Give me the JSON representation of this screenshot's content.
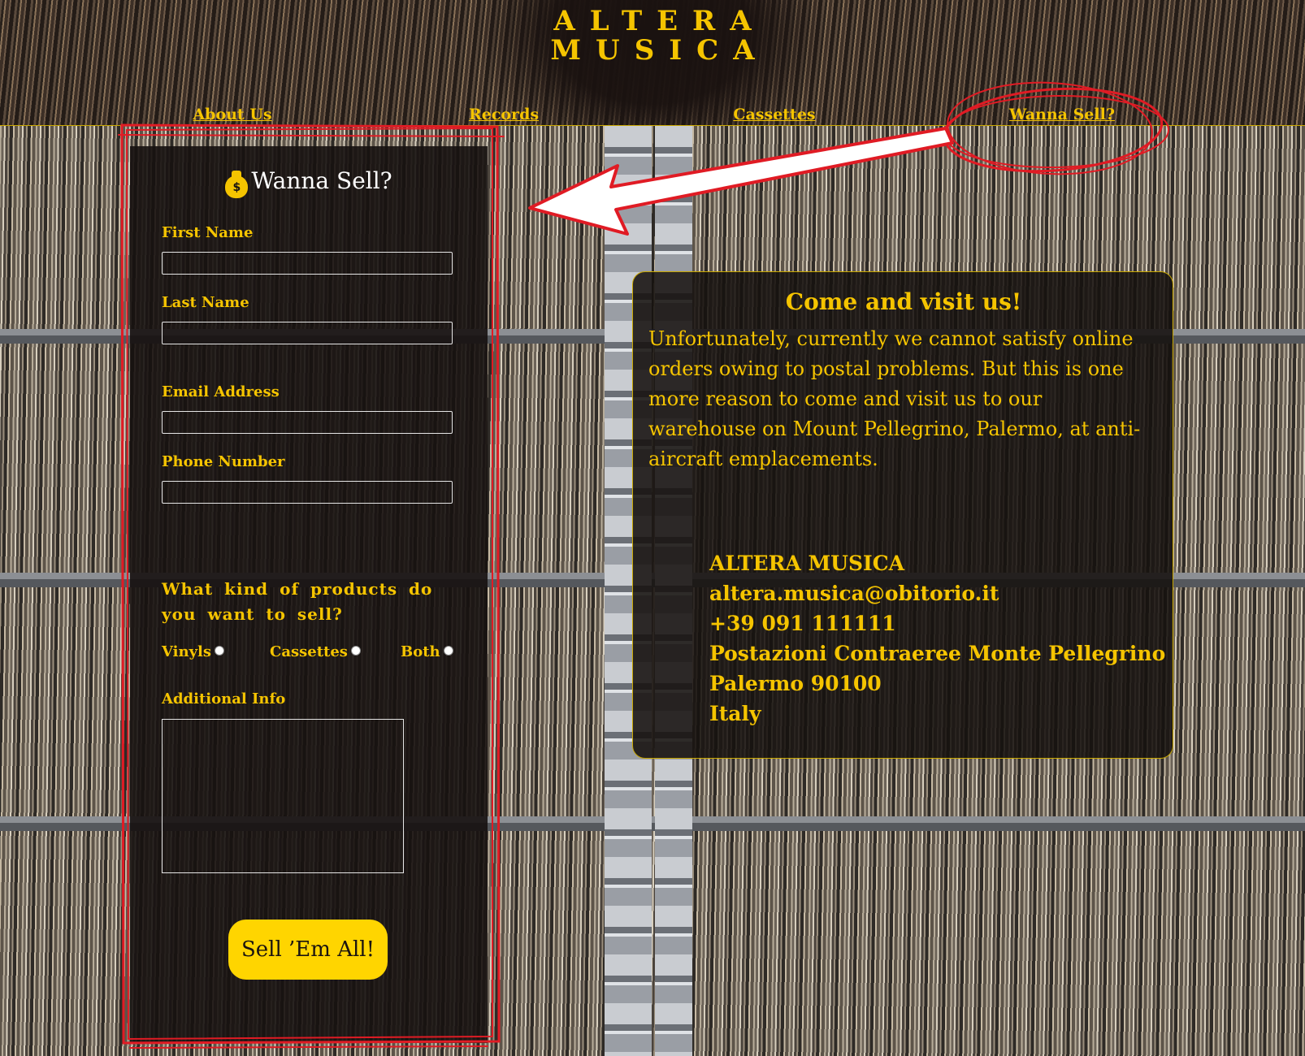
{
  "brand": {
    "line1": "ALTERA",
    "line2": "MUSICA"
  },
  "nav": {
    "about": "About Us",
    "records": "Records",
    "cassettes": "Cassettes",
    "sell": "Wanna Sell?"
  },
  "form": {
    "title": "Wanna Sell?",
    "bag_symbol": "$",
    "first_name_label": "First Name",
    "last_name_label": "Last Name",
    "email_label": "Email Address",
    "phone_label": "Phone Number",
    "question": "What kind of products do you want to sell?",
    "options": {
      "vinyls": "Vinyls",
      "cassettes": "Cassettes",
      "both": "Both"
    },
    "additional_label": "Additional Info",
    "submit_label": "Sell ’Em All!"
  },
  "info": {
    "title": "Come and visit us!",
    "body": "Unfortunately, currently we cannot satisfy online orders owing to postal problems. But this is one more reason to come and visit us to our warehouse on Mount Pellegrino, Palermo, at anti-aircraft emplacements.",
    "address": {
      "name": "ALTERA MUSICA",
      "email": "altera.musica@obitorio.it",
      "phone": "+39 091 111111",
      "street": "Postazioni Contraeree Monte Pellegrino",
      "city": "Palermo 90100",
      "country": "Italy"
    }
  },
  "colors": {
    "accent": "#f5c400",
    "button": "#ffd500",
    "panel": "#16110f",
    "annotation": "#e01b24"
  },
  "icons": {
    "form_title": "money-bag-icon"
  }
}
